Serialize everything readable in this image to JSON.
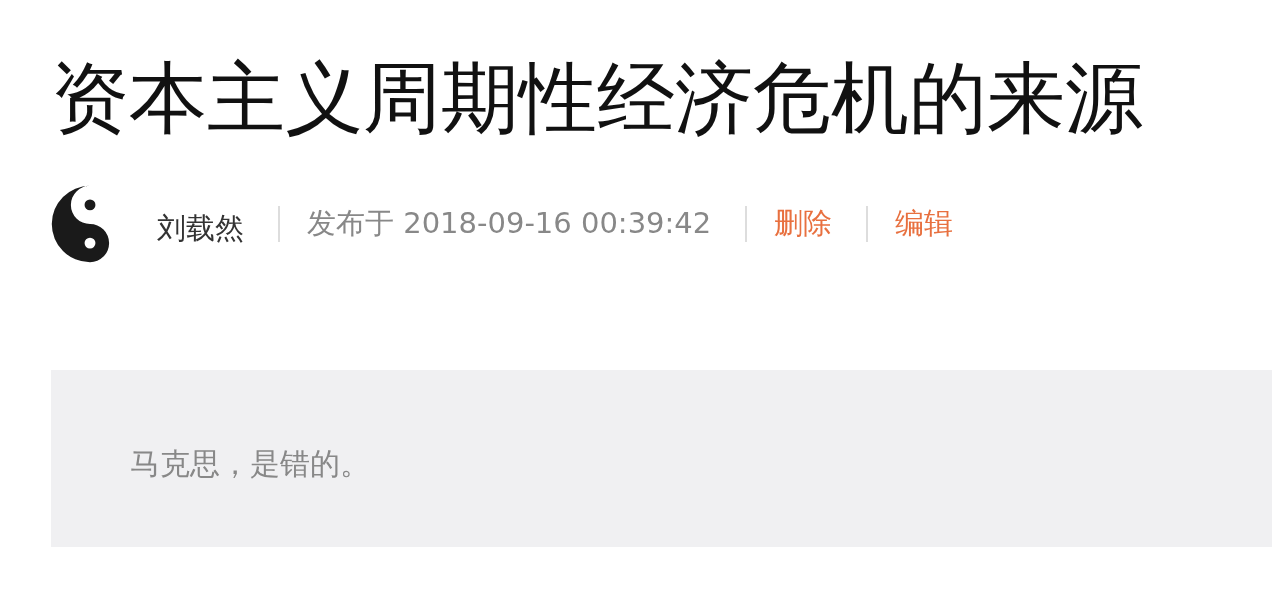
{
  "title": "资本主义周期性经济危机的来源",
  "meta": {
    "author": "刘载然",
    "published": "发布于 2018-09-16 00:39:42"
  },
  "actions": [
    {
      "label": "删除"
    },
    {
      "label": "编辑"
    }
  ],
  "quote": "马克思，是错的。"
}
